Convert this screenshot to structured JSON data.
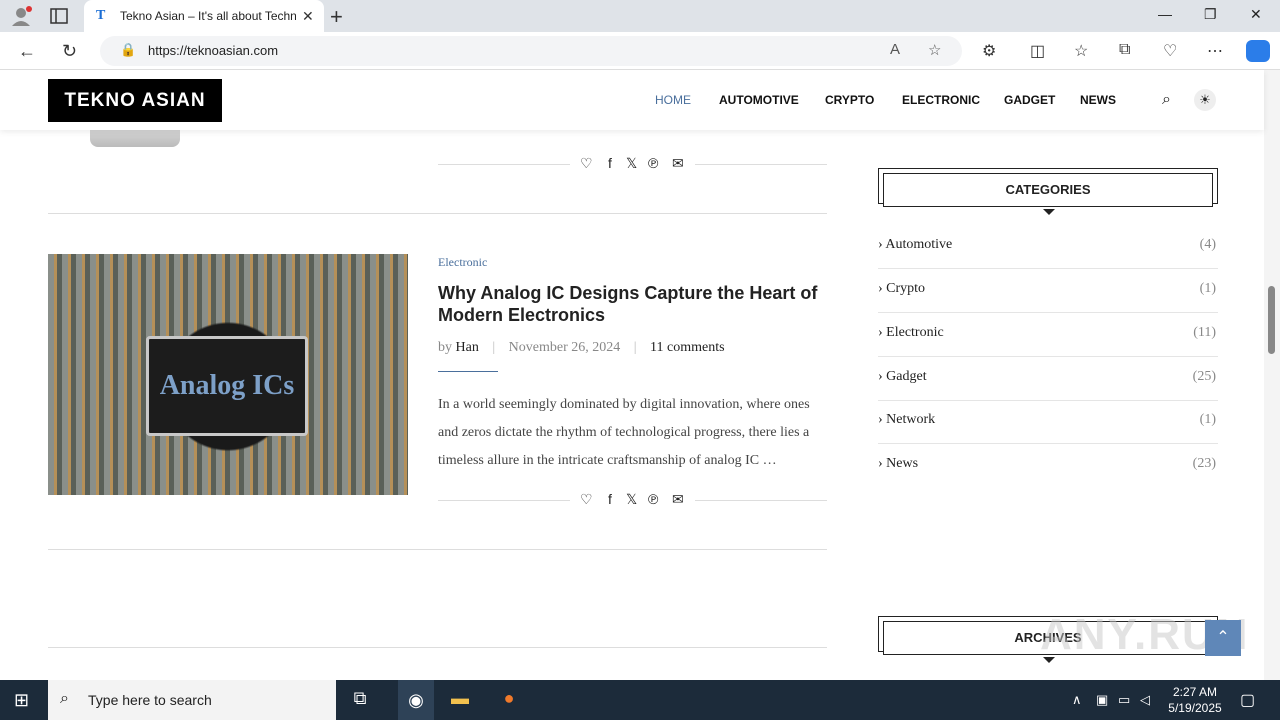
{
  "browser": {
    "tab_title": "Tekno Asian – It's all about Techn",
    "tab_favicon": "T",
    "url": "https://teknoasian.com"
  },
  "site": {
    "logo": "TEKNO ASIAN",
    "menu": [
      "HOME",
      "AUTOMOTIVE",
      "CRYPTO",
      "ELECTRONIC",
      "GADGET",
      "NEWS"
    ],
    "prev_excerpt_tail": "…   …    …  …  …  …  …  …"
  },
  "post": {
    "category": "Electronic",
    "title": "Why Analog IC Designs Capture the Heart of Modern Electronics",
    "author_prefix": "by",
    "author": "Han",
    "date": "November 26, 2024",
    "comments": "11 comments",
    "excerpt": "In a world seemingly dominated by digital innovation, where ones and zeros dictate the rhythm of technological progress, there lies a timeless allure in the intricate craftsmanship of analog IC  …",
    "image_text": "Analog ICs"
  },
  "sidebar": {
    "categories_title": "CATEGORIES",
    "categories": [
      {
        "name": "Automotive",
        "count": "(4)"
      },
      {
        "name": "Crypto",
        "count": "(1)"
      },
      {
        "name": "Electronic",
        "count": "(11)"
      },
      {
        "name": "Gadget",
        "count": "(25)"
      },
      {
        "name": "Network",
        "count": "(1)"
      },
      {
        "name": "News",
        "count": "(23)"
      }
    ],
    "archives_title": "ARCHIVES"
  },
  "taskbar": {
    "search_placeholder": "Type here to search",
    "time": "2:27 AM",
    "date": "5/19/2025"
  },
  "watermark": "ANY.RUN",
  "colors": {
    "accent": "#4a6f9c",
    "taskbar": "#1c2b3a",
    "logo_bg": "#000000"
  }
}
